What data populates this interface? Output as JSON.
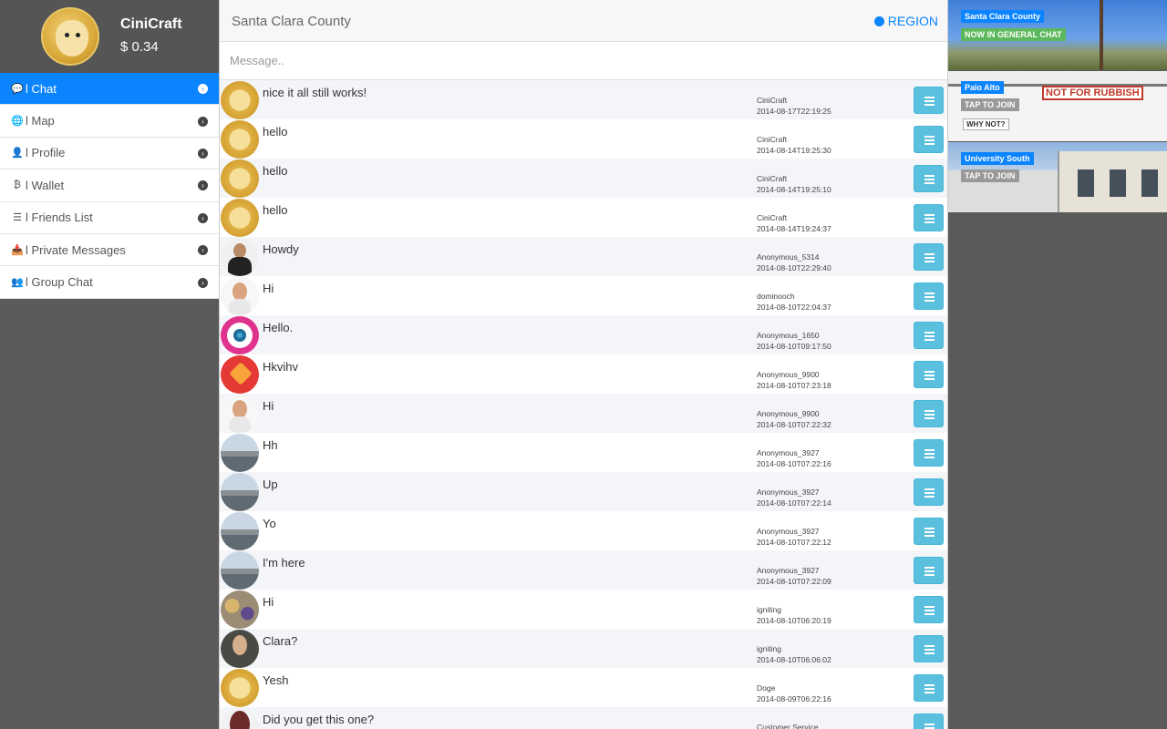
{
  "profile": {
    "username": "CiniCraft",
    "balance": "$ 0.34"
  },
  "nav": [
    {
      "icon": "chat-icon",
      "glyph": "💬",
      "label": "l Chat",
      "active": true
    },
    {
      "icon": "globe-icon",
      "glyph": "🌐",
      "label": "l Map",
      "active": false
    },
    {
      "icon": "user-icon",
      "glyph": "👤",
      "label": "l Profile",
      "active": false
    },
    {
      "icon": "bitcoin-icon",
      "glyph": "₿",
      "label": "l Wallet",
      "active": false
    },
    {
      "icon": "list-icon",
      "glyph": "☰",
      "label": "l Friends List",
      "active": false
    },
    {
      "icon": "inbox-icon",
      "glyph": "📥",
      "label": "l Private Messages",
      "active": false
    },
    {
      "icon": "group-icon",
      "glyph": "👥",
      "label": "l Group Chat",
      "active": false
    }
  ],
  "header": {
    "county": "Santa Clara County",
    "region_label": "REGION"
  },
  "composer": {
    "placeholder": "Message.."
  },
  "messages": [
    {
      "text": "nice it all still works!",
      "user": "CiniCraft",
      "time": "2014-08-17T22:19:25",
      "avatar": "doge"
    },
    {
      "text": "hello",
      "user": "CiniCraft",
      "time": "2014-08-14T19:25:30",
      "avatar": "doge"
    },
    {
      "text": "hello",
      "user": "CiniCraft",
      "time": "2014-08-14T19:25:10",
      "avatar": "doge"
    },
    {
      "text": "hello",
      "user": "CiniCraft",
      "time": "2014-08-14T19:24:37",
      "avatar": "doge"
    },
    {
      "text": "Howdy",
      "user": "Anonymous_5314",
      "time": "2014-08-10T22:29:40",
      "avatar": "suit"
    },
    {
      "text": "Hi",
      "user": "dominooch",
      "time": "2014-08-10T22:04:37",
      "avatar": "man"
    },
    {
      "text": "Hello.",
      "user": "Anonymous_1650",
      "time": "2014-08-10T09:17:50",
      "avatar": "eye"
    },
    {
      "text": "Hkvihv",
      "user": "Anonymous_9900",
      "time": "2014-08-10T07:23:18",
      "avatar": "tag"
    },
    {
      "text": "Hi",
      "user": "Anonymous_9900",
      "time": "2014-08-10T07:22:32",
      "avatar": "man"
    },
    {
      "text": "Hh",
      "user": "Anonymous_3927",
      "time": "2014-08-10T07:22:16",
      "avatar": "beach"
    },
    {
      "text": "Up",
      "user": "Anonymous_3927",
      "time": "2014-08-10T07:22:14",
      "avatar": "beach"
    },
    {
      "text": "Yo",
      "user": "Anonymous_3927",
      "time": "2014-08-10T07:22:12",
      "avatar": "beach"
    },
    {
      "text": "I'm here",
      "user": "Anonymous_3927",
      "time": "2014-08-10T07:22:09",
      "avatar": "beach"
    },
    {
      "text": "Hi",
      "user": "igniting",
      "time": "2014-08-10T06:20:19",
      "avatar": "crowd"
    },
    {
      "text": "Clara?",
      "user": "igniting",
      "time": "2014-08-10T06:06:02",
      "avatar": "girl"
    },
    {
      "text": "Yesh",
      "user": "Doge",
      "time": "2014-08-09T06:22:16",
      "avatar": "doge"
    },
    {
      "text": "Did you get this one?",
      "user": "Customer Service",
      "time": "",
      "avatar": "lady"
    }
  ],
  "rooms": [
    {
      "name": "Santa Clara County",
      "status": "NOW IN GENERAL CHAT",
      "scene": "r1"
    },
    {
      "name": "Palo Alto",
      "tap": "TAP TO JOIN",
      "sign": "NOT FOR RUBBISH",
      "why": "WHY NOT?",
      "scene": "r2"
    },
    {
      "name": "University South",
      "tap": "TAP TO JOIN",
      "scene": "r3"
    }
  ]
}
